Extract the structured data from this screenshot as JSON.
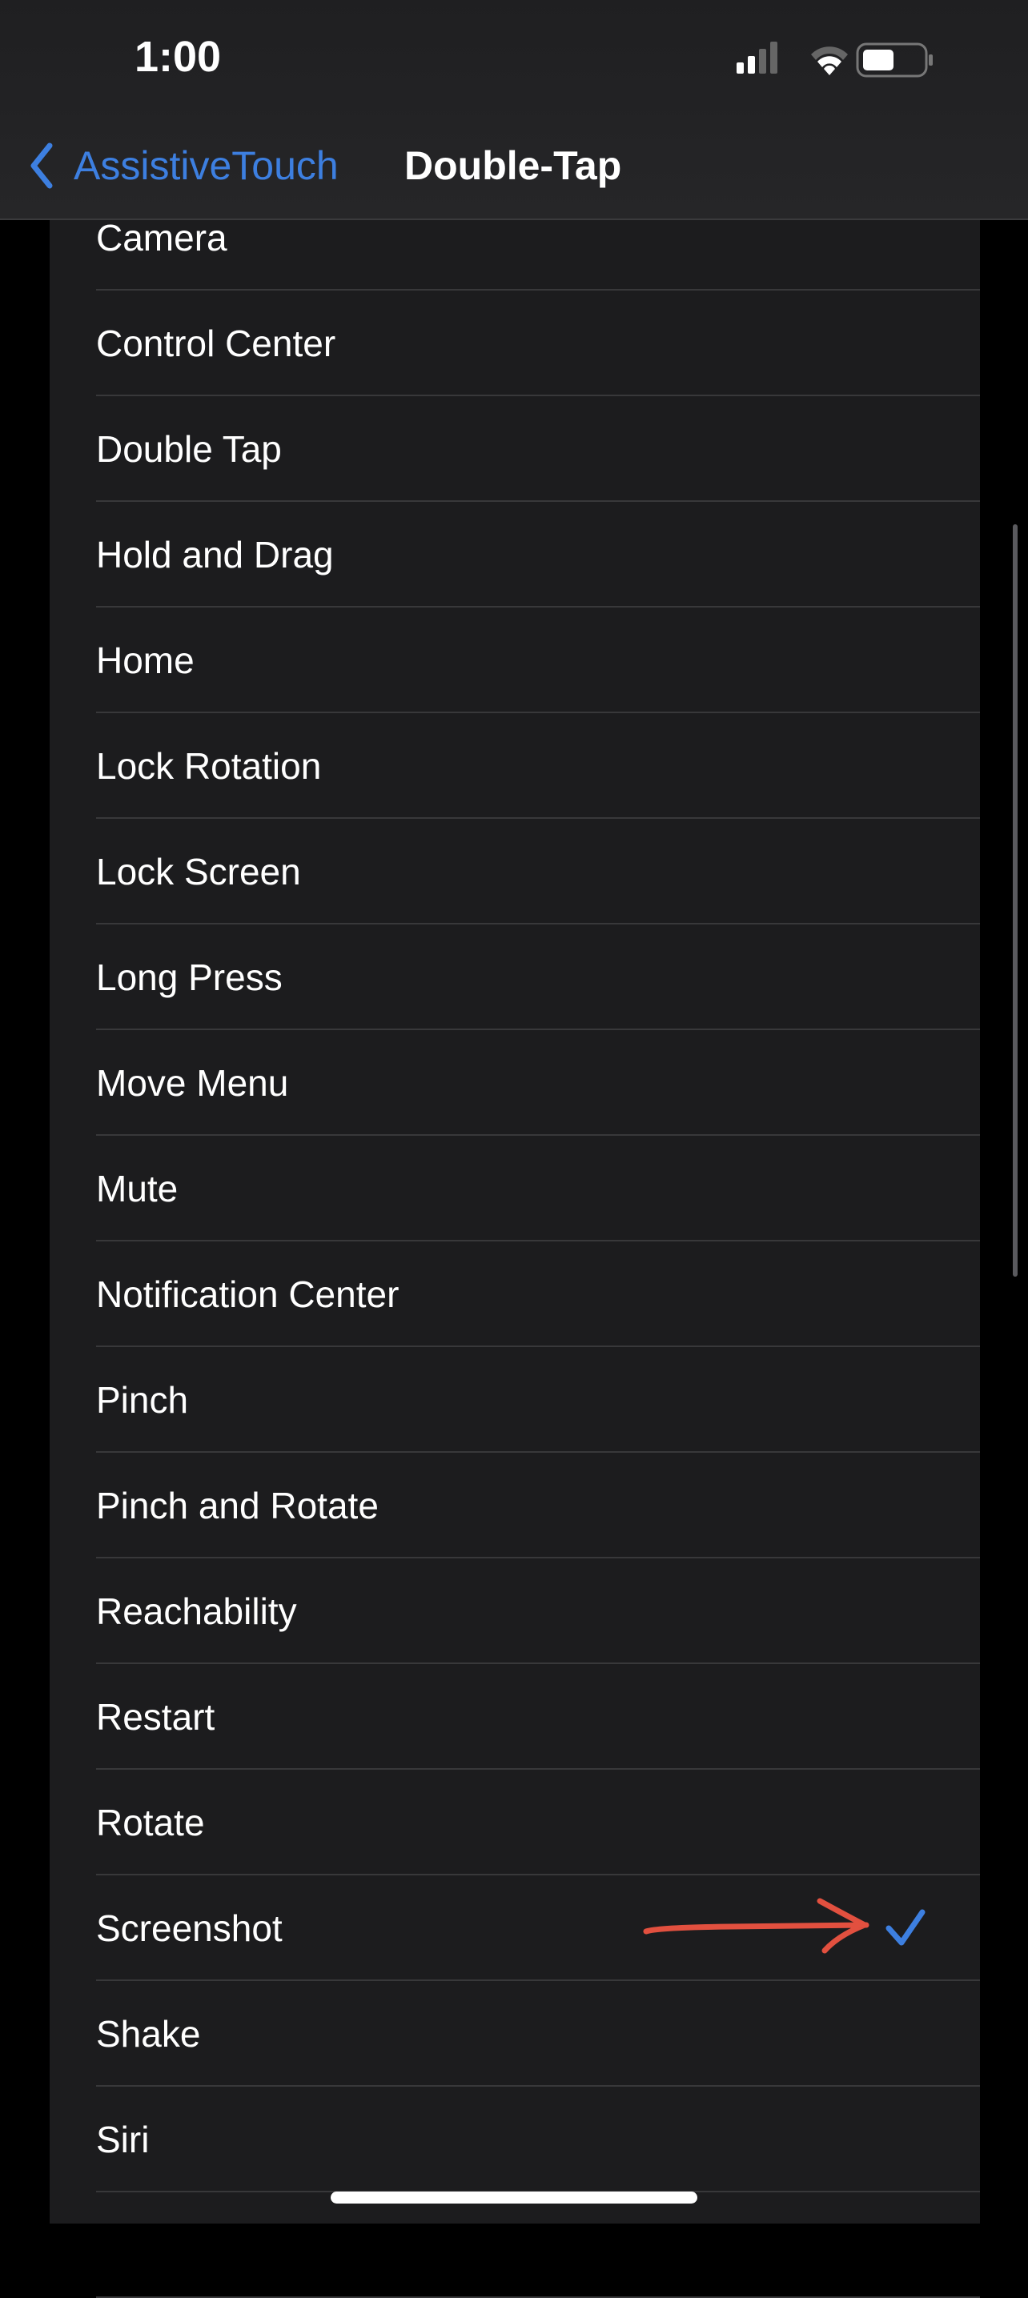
{
  "status_bar": {
    "time": "1:00",
    "signal_bars_filled": 2,
    "signal_bars_total": 4,
    "battery_level": 0.5
  },
  "nav": {
    "back_label": "AssistiveTouch",
    "title": "Double-Tap"
  },
  "colors": {
    "accent": "#3d7fe0",
    "annotation_arrow": "#e2503f",
    "background": "#1c1c1e"
  },
  "list": {
    "selected": "Screenshot",
    "items": [
      {
        "label": "Camera"
      },
      {
        "label": "Control Center"
      },
      {
        "label": "Double Tap"
      },
      {
        "label": "Hold and Drag"
      },
      {
        "label": "Home"
      },
      {
        "label": "Lock Rotation"
      },
      {
        "label": "Lock Screen"
      },
      {
        "label": "Long Press"
      },
      {
        "label": "Move Menu"
      },
      {
        "label": "Mute"
      },
      {
        "label": "Notification Center"
      },
      {
        "label": "Pinch"
      },
      {
        "label": "Pinch and Rotate"
      },
      {
        "label": "Reachability"
      },
      {
        "label": "Restart"
      },
      {
        "label": "Rotate"
      },
      {
        "label": "Screenshot",
        "checked": true,
        "annotated": true
      },
      {
        "label": "Shake"
      },
      {
        "label": "Siri"
      },
      {
        "label": ""
      }
    ]
  }
}
